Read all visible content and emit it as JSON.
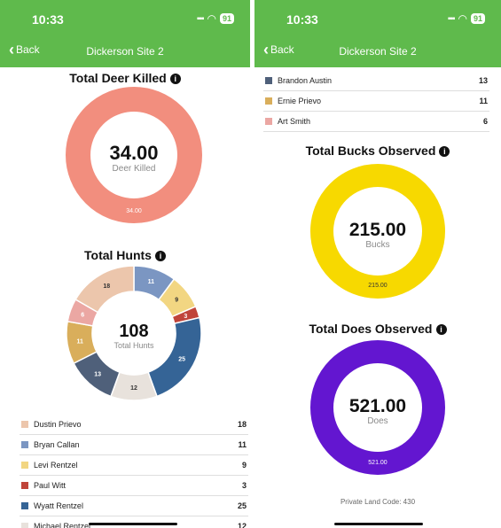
{
  "status_bar": {
    "time": "10:33",
    "battery": "91"
  },
  "nav": {
    "back_label": "Back",
    "title": "Dickerson Site 2"
  },
  "deer_killed": {
    "title": "Total Deer Killed",
    "center_value": "34.00",
    "center_label": "Deer Killed",
    "slice_label": "34.00",
    "color": "#f28e7e"
  },
  "hunts": {
    "title": "Total Hunts",
    "center_value": "108",
    "center_label": "Total Hunts",
    "legend": [
      {
        "name": "Dustin Prievo",
        "value": "18",
        "color": "#ecc6ac"
      },
      {
        "name": "Bryan Callan",
        "value": "11",
        "color": "#7b96c2"
      },
      {
        "name": "Levi Rentzel",
        "value": "9",
        "color": "#f2d682"
      },
      {
        "name": "Paul Witt",
        "value": "3",
        "color": "#c0443a"
      },
      {
        "name": "Wyatt Rentzel",
        "value": "25",
        "color": "#356496"
      },
      {
        "name": "Michael Rentzel",
        "value": "12",
        "color": "#e8e2dc"
      }
    ],
    "legend_continued": [
      {
        "name": "Brandon Austin",
        "value": "13",
        "color": "#4f607a"
      },
      {
        "name": "Ernie Prievo",
        "value": "11",
        "color": "#d9ae5b"
      },
      {
        "name": "Art Smith",
        "value": "6",
        "color": "#eba7a3"
      }
    ]
  },
  "bucks": {
    "title": "Total Bucks Observed",
    "center_value": "215.00",
    "center_label": "Bucks",
    "slice_label": "215.00",
    "color": "#f7d900"
  },
  "does": {
    "title": "Total Does Observed",
    "center_value": "521.00",
    "center_label": "Does",
    "slice_label": "521.00",
    "color": "#6316d0"
  },
  "footer": {
    "land_code": "Private Land Code: 430"
  },
  "chart_data": [
    {
      "type": "pie",
      "title": "Total Deer Killed",
      "categories": [
        "Deer Killed"
      ],
      "values": [
        34
      ]
    },
    {
      "type": "pie",
      "title": "Total Hunts",
      "categories": [
        "Bryan Callan",
        "Levi Rentzel",
        "Paul Witt",
        "Wyatt Rentzel",
        "Michael Rentzel",
        "Brandon Austin",
        "Ernie Prievo",
        "Art Smith",
        "Dustin Prievo"
      ],
      "values": [
        11,
        9,
        3,
        25,
        12,
        13,
        11,
        6,
        18
      ],
      "colors": [
        "#7b96c2",
        "#f2d682",
        "#c0443a",
        "#356496",
        "#e8e2dc",
        "#4f607a",
        "#d9ae5b",
        "#eba7a3",
        "#ecc6ac"
      ]
    },
    {
      "type": "pie",
      "title": "Total Bucks Observed",
      "categories": [
        "Bucks"
      ],
      "values": [
        215
      ]
    },
    {
      "type": "pie",
      "title": "Total Does Observed",
      "categories": [
        "Does"
      ],
      "values": [
        521
      ]
    }
  ]
}
